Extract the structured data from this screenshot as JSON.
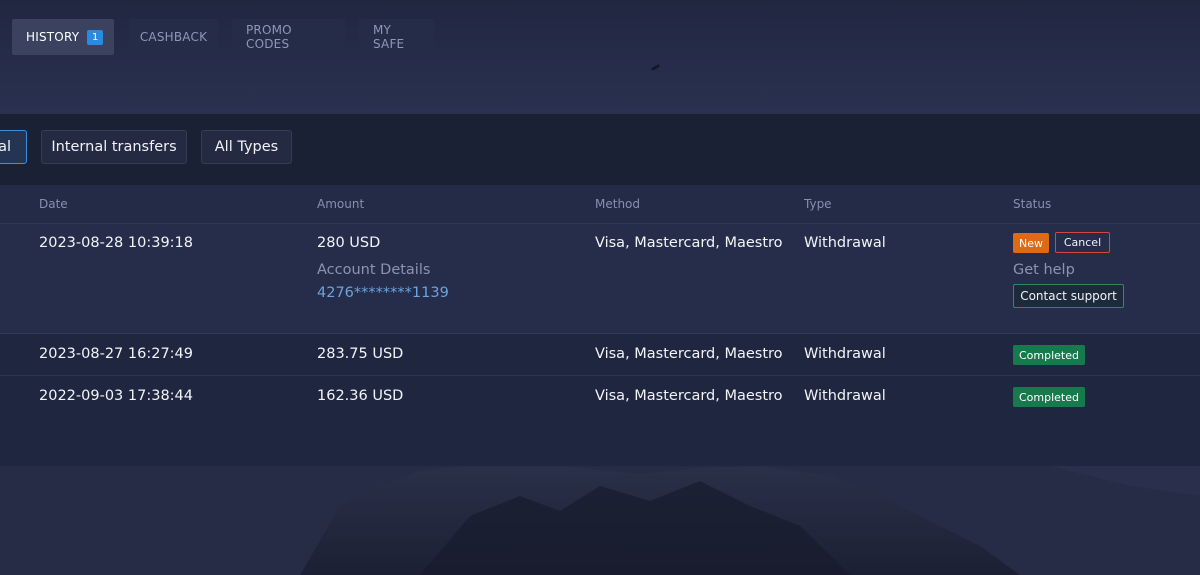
{
  "tabs": [
    {
      "label": "HISTORY",
      "badge": "1"
    },
    {
      "label": "CASHBACK"
    },
    {
      "label": "PROMO CODES"
    },
    {
      "label": "MY SAFE"
    }
  ],
  "filters": [
    {
      "label": "al"
    },
    {
      "label": "Internal transfers"
    },
    {
      "label": "All Types"
    }
  ],
  "table": {
    "headers": {
      "date": "Date",
      "amount": "Amount",
      "method": "Method",
      "type": "Type",
      "status": "Status"
    },
    "rows": [
      {
        "date": "2023-08-28 10:39:18",
        "amount": "280 USD",
        "method": "Visa, Mastercard, Maestro",
        "type": "Withdrawal",
        "status": "New",
        "cancel_label": "Cancel",
        "account_details_label": "Account Details",
        "account_details_value": "4276********1139",
        "help_label": "Get help",
        "support_label": "Contact support"
      },
      {
        "date": "2023-08-27 16:27:49",
        "amount": "283.75 USD",
        "method": "Visa, Mastercard, Maestro",
        "type": "Withdrawal",
        "status": "Completed"
      },
      {
        "date": "2022-09-03 17:38:44",
        "amount": "162.36 USD",
        "method": "Visa, Mastercard, Maestro",
        "type": "Withdrawal",
        "status": "Completed"
      }
    ]
  },
  "colors": {
    "badge_new": "#dd6a14",
    "badge_completed": "#167a4d",
    "tab_badge": "#2a8adf",
    "link": "#6ba4de"
  }
}
